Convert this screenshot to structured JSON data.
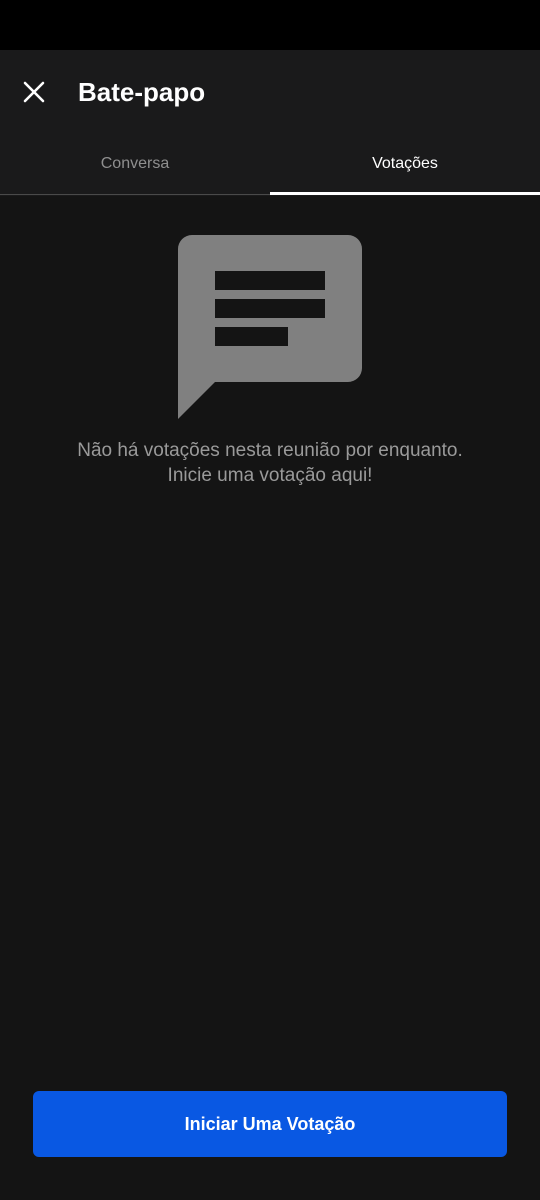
{
  "header": {
    "title": "Bate-papo",
    "close_icon": "close-icon"
  },
  "tabs": [
    {
      "label": "Conversa",
      "active": false
    },
    {
      "label": "Votações",
      "active": true
    }
  ],
  "empty_state": {
    "icon": "chat-message-icon",
    "message": "Não há votações nesta reunião por enquanto. Inicie uma votação aqui!"
  },
  "footer": {
    "start_poll_label": "Iniciar Uma Votação"
  },
  "colors": {
    "background": "#141414",
    "header_background": "#1a1a1b",
    "accent": "#0958e3",
    "icon_gray": "#808080"
  }
}
